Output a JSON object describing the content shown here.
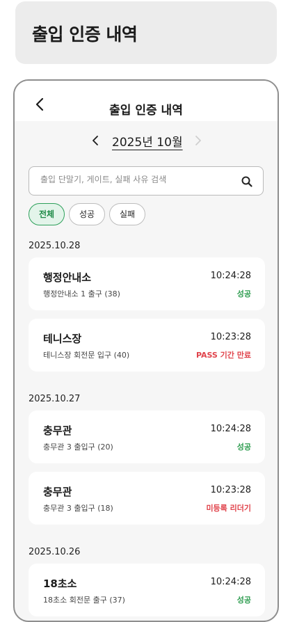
{
  "page_title": "출입 인증 내역",
  "screen": {
    "header_title": "출입 인증 내역",
    "month": "2025년 10월",
    "search": {
      "placeholder": "출입 단말기, 게이트, 실패 사유 검색"
    },
    "filters": [
      "전체",
      "성공",
      "실패"
    ],
    "selected_filter": "전체",
    "groups": [
      {
        "date": "2025.10.28",
        "records": [
          {
            "name": "행정안내소",
            "detail": "행정안내소 1 출구 (38)",
            "time": "10:24:28",
            "status": "성공",
            "result": "success"
          },
          {
            "name": "테니스장",
            "detail": "테니스장 회전문 입구 (40)",
            "time": "10:23:28",
            "status": "PASS 기간 만료",
            "result": "fail"
          }
        ]
      },
      {
        "date": "2025.10.27",
        "records": [
          {
            "name": "충무관",
            "detail": "충무관 3 출입구 (20)",
            "time": "10:24:28",
            "status": "성공",
            "result": "success"
          },
          {
            "name": "충무관",
            "detail": "충무관 3 출입구 (18)",
            "time": "10:23:28",
            "status": "미등록 리더기",
            "result": "fail"
          }
        ]
      },
      {
        "date": "2025.10.26",
        "records": [
          {
            "name": "18초소",
            "detail": "18초소 회전문 출구 (37)",
            "time": "10:24:28",
            "status": "성공",
            "result": "success"
          }
        ]
      }
    ]
  },
  "colors": {
    "success": "#2d9c4f",
    "fail": "#e0434b",
    "chip_active_bg": "#e3f4ea",
    "chip_active_border": "#2da05a"
  }
}
